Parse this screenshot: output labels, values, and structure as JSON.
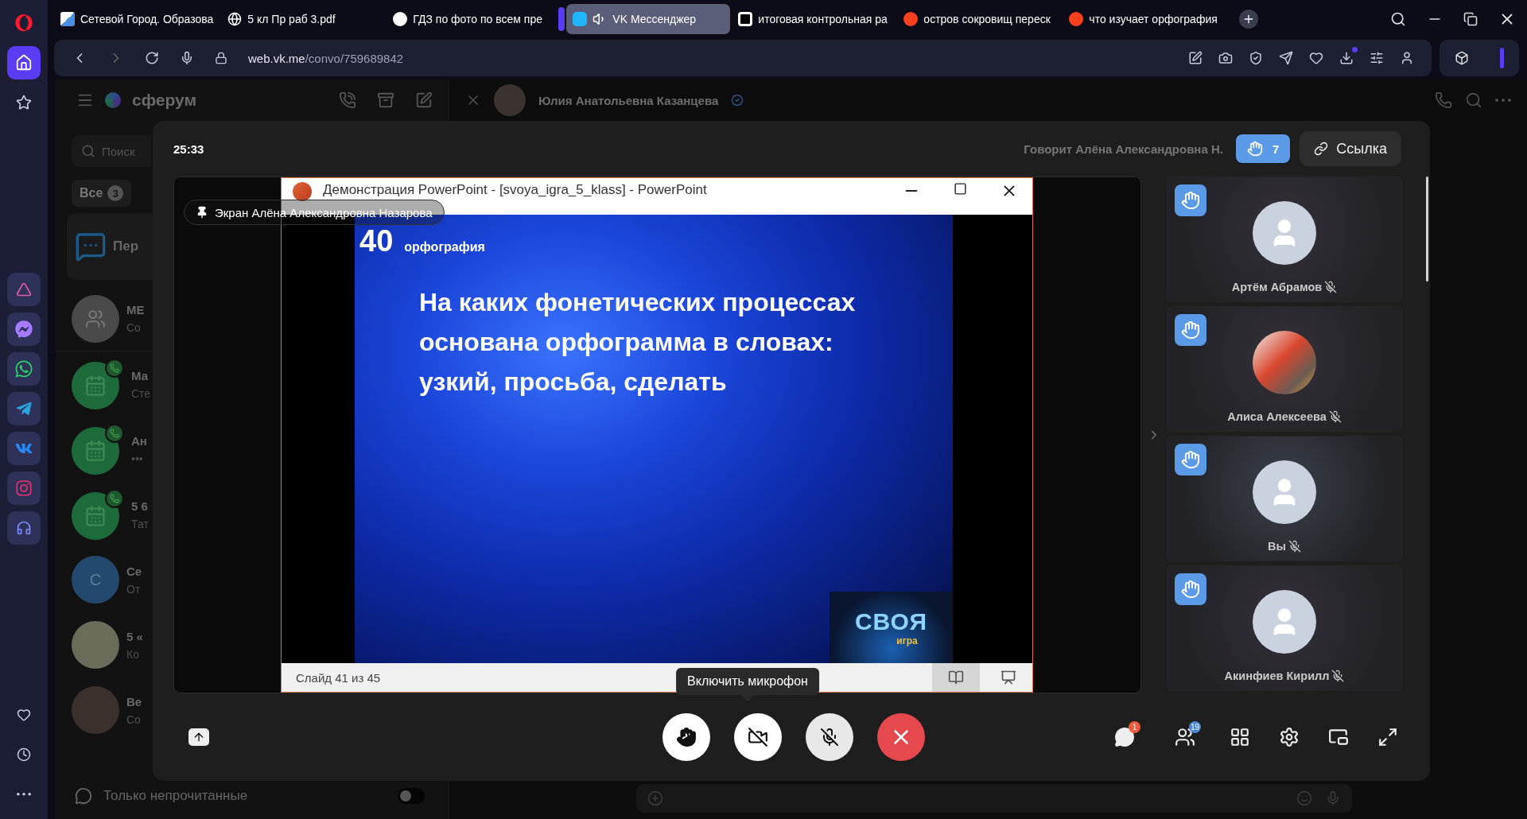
{
  "browser": {
    "tabs": [
      {
        "title": "Сетевой Город. Образова",
        "audio": false,
        "selected": false
      },
      {
        "title": "5 кл Пр раб 3.pdf",
        "audio": false,
        "selected": false
      },
      {
        "title": "ГДЗ по фото по всем пре",
        "audio": false,
        "selected": false
      },
      {
        "title": "VK Мессенджер",
        "audio": true,
        "selected": true
      },
      {
        "title": "итоговая контрольная ра",
        "audio": false,
        "selected": false
      },
      {
        "title": "остров сокровищ переск",
        "audio": false,
        "selected": false
      },
      {
        "title": "что изучает орфография",
        "audio": false,
        "selected": false
      }
    ],
    "address": {
      "host": "web.vk.me",
      "path": "/convo/759689842"
    }
  },
  "messenger": {
    "brand": "сферум",
    "search_placeholder": "Поиск",
    "filter": {
      "label": "Все",
      "count": "3"
    },
    "chats": [
      {
        "kind": "pinned",
        "name": "Пер"
      },
      {
        "kind": "group",
        "name": "МЕ",
        "preview": "Со"
      },
      {
        "kind": "call",
        "name": "Ма",
        "preview": "Сте"
      },
      {
        "kind": "call",
        "name": "Ан",
        "preview": "•••"
      },
      {
        "kind": "call",
        "name": "5 6",
        "preview": "Тат"
      },
      {
        "kind": "letter",
        "initial": "С",
        "name": "Се",
        "preview": "От"
      },
      {
        "kind": "sign",
        "name": "5 «",
        "preview": "Ко"
      },
      {
        "kind": "photo",
        "name": "Ве",
        "preview": "Со"
      }
    ],
    "unread_only": {
      "label": "Только непрочитанные",
      "on": false
    },
    "conversation": {
      "title": "Юлия Анатольевна Казанцева"
    }
  },
  "call": {
    "timer": "25:33",
    "speaker": "Говорит **Алёна Александровна Н.**",
    "raised_hands": "7",
    "link_button": "Ссылка",
    "screen_label": "Экран Алёна Александровна Назарова",
    "presentation": {
      "window_title": "Демонстрация PowerPoint - [svoya_igra_5_klass] - PowerPoint",
      "points": "40",
      "category": "орфография",
      "question": "На каких фонетических процессах\nоснована орфограмма в словах:\nузкий, просьба, сделать",
      "logo_title": "СВОЯ",
      "logo_subtitle": "игра",
      "status": "Слайд 41 из 45"
    },
    "participants": [
      {
        "kind": "default",
        "name": "Артём Абрамов",
        "hand_raised": true,
        "muted": true
      },
      {
        "kind": "photo",
        "name": "Алиса Алексеева",
        "hand_raised": true,
        "muted": true
      },
      {
        "kind": "default",
        "name": "Вы",
        "hand_raised": true,
        "muted": true
      },
      {
        "kind": "default",
        "name": "Акинфиев Кирилл",
        "hand_raised": true,
        "muted": true
      }
    ],
    "camera_on": false,
    "mic_on": false,
    "mic_tooltip": "Включить микрофон",
    "chat_badge": "1",
    "people_badge": "19"
  }
}
